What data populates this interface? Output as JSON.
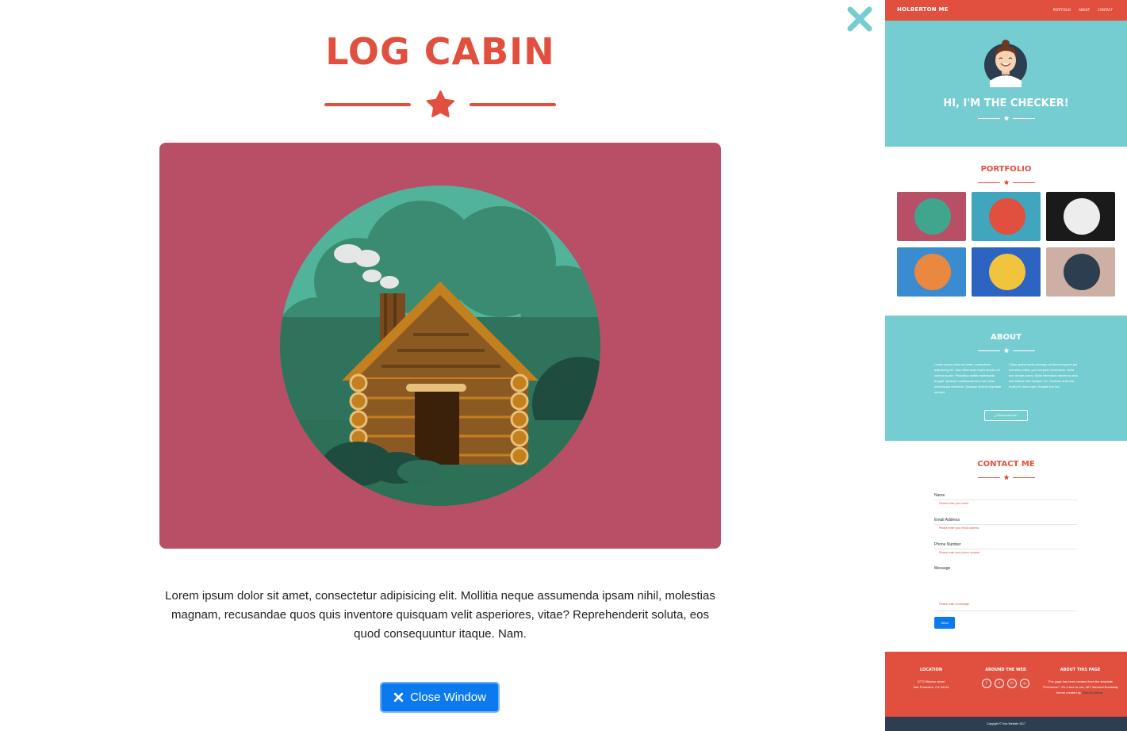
{
  "modal": {
    "title": "LOG CABIN",
    "description": "Lorem ipsum dolor sit amet, consectetur adipisicing elit. Mollitia neque assumenda ipsam nihil, molestias magnam, recusandae quos quis inventore quisquam velit asperiores, vitae? Reprehenderit soluta, eos quod consequuntur itaque. Nam.",
    "close_button_label": "Close Window",
    "image_bg": "#B84F66"
  },
  "colors": {
    "accent": "#E1503E",
    "teal": "#76CDD1",
    "button_blue": "#0A7AEE",
    "dark": "#2C3E50"
  },
  "page": {
    "nav": {
      "brand": "HOLBERTON ME",
      "links": [
        "PORTFOLIO",
        "ABOUT",
        "CONTACT"
      ]
    },
    "hero": {
      "title": "HI, I'M THE CHECKER!"
    },
    "portfolio": {
      "title": "PORTFOLIO",
      "tiles": [
        {
          "name": "cabin",
          "bg": "#B84F66",
          "circle": "#3FA58C"
        },
        {
          "name": "cake",
          "bg": "#3FA6BD",
          "circle": "#E1503E"
        },
        {
          "name": "circus",
          "bg": "#1A1A1A",
          "circle": "#EDEDED"
        },
        {
          "name": "game",
          "bg": "#3B8BD0",
          "circle": "#E9883E"
        },
        {
          "name": "safe",
          "bg": "#2D63C1",
          "circle": "#F0C43D"
        },
        {
          "name": "submarine",
          "bg": "#CDAFA4",
          "circle": "#2C3E50"
        }
      ]
    },
    "about": {
      "title": "ABOUT",
      "col1": "Lorem ipsum dolor sit amet, consectetur adipiscing elit. Nam bibendum turpis iaculis vel viverra auctor. Phasellus mattis malesuada feugiat. Quisque malesuada arcu non risus scelerisque interdum. Quisque viverra vulputate semper.",
      "col2": "Class aptent taciti sociosqu ad litora torquent per conubia nostra, per inceptos himenaeos. Nulla non ornare purus. Nulla bibendum maximus urna, sed finibus velit tristique vel. Vivamus ante nisl, mollis et varius quis, feugiat non dui.",
      "download_label": "Download me!"
    },
    "contact": {
      "title": "CONTACT ME",
      "fields": [
        {
          "label": "Name",
          "error": "Please enter your name."
        },
        {
          "label": "Email Address",
          "error": "Please enter your email address."
        },
        {
          "label": "Phone Number",
          "error": "Please enter your phone number."
        },
        {
          "label": "Message",
          "error": "Please enter a message."
        }
      ],
      "send_label": "Send"
    },
    "footer": {
      "location_head": "LOCATION",
      "location_line1": "3772 Mission street",
      "location_line2": "San Francisco, CA 94114",
      "web_head": "AROUND THE WEB",
      "social": [
        "f",
        "t",
        "in",
        "◎"
      ],
      "about_head": "ABOUT THIS PAGE",
      "about_text": "This page has been created from the template \"Freelancer\". It's a free to use, MIT licensed Bootstrap theme created by",
      "about_link": "Start Bootstrap",
      "copyright": "Copyright © Your Website 2017"
    }
  }
}
